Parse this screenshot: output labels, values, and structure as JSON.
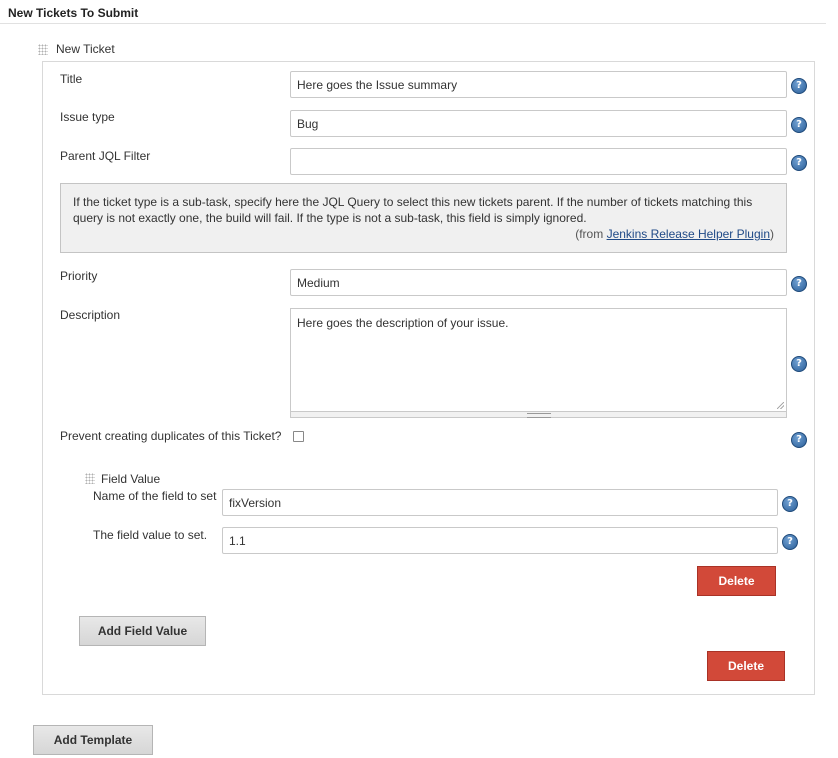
{
  "section": {
    "title": "New Tickets To Submit"
  },
  "ticket": {
    "header": "New Ticket",
    "fields": {
      "title": {
        "label": "Title",
        "value": "Here goes the Issue summary"
      },
      "issue_type": {
        "label": "Issue type",
        "value": "Bug"
      },
      "parent_jql": {
        "label": "Parent JQL Filter",
        "value": ""
      },
      "priority": {
        "label": "Priority",
        "value": "Medium"
      },
      "description": {
        "label": "Description",
        "value": "Here goes the description of your issue."
      },
      "prevent_duplicates": {
        "label": "Prevent creating duplicates of this Ticket?",
        "checked": false
      }
    },
    "help_panel": {
      "text": "If the ticket type is a sub-task, specify here the JQL Query to select this new tickets parent. If the number of tickets matching this query is not exactly one, the build will fail. If the type is not a sub-task, this field is simply ignored.",
      "from_prefix": "(from ",
      "from_link": "Jenkins Release Helper Plugin",
      "from_suffix": ")"
    },
    "field_value": {
      "header": "Field Value",
      "name_label": "Name of the field to set",
      "name_value": "fixVersion",
      "value_label": "The field value to set.",
      "value_value": "1.1",
      "delete_label": "Delete"
    },
    "add_field_value_label": "Add Field Value",
    "delete_label": "Delete"
  },
  "add_template_label": "Add Template",
  "colors": {
    "delete_button": "#d24939",
    "link": "#204a87",
    "help_icon": "#2b5f99"
  },
  "icons": {
    "help": "question-mark-circle-icon",
    "drag": "drag-handle-icon"
  }
}
